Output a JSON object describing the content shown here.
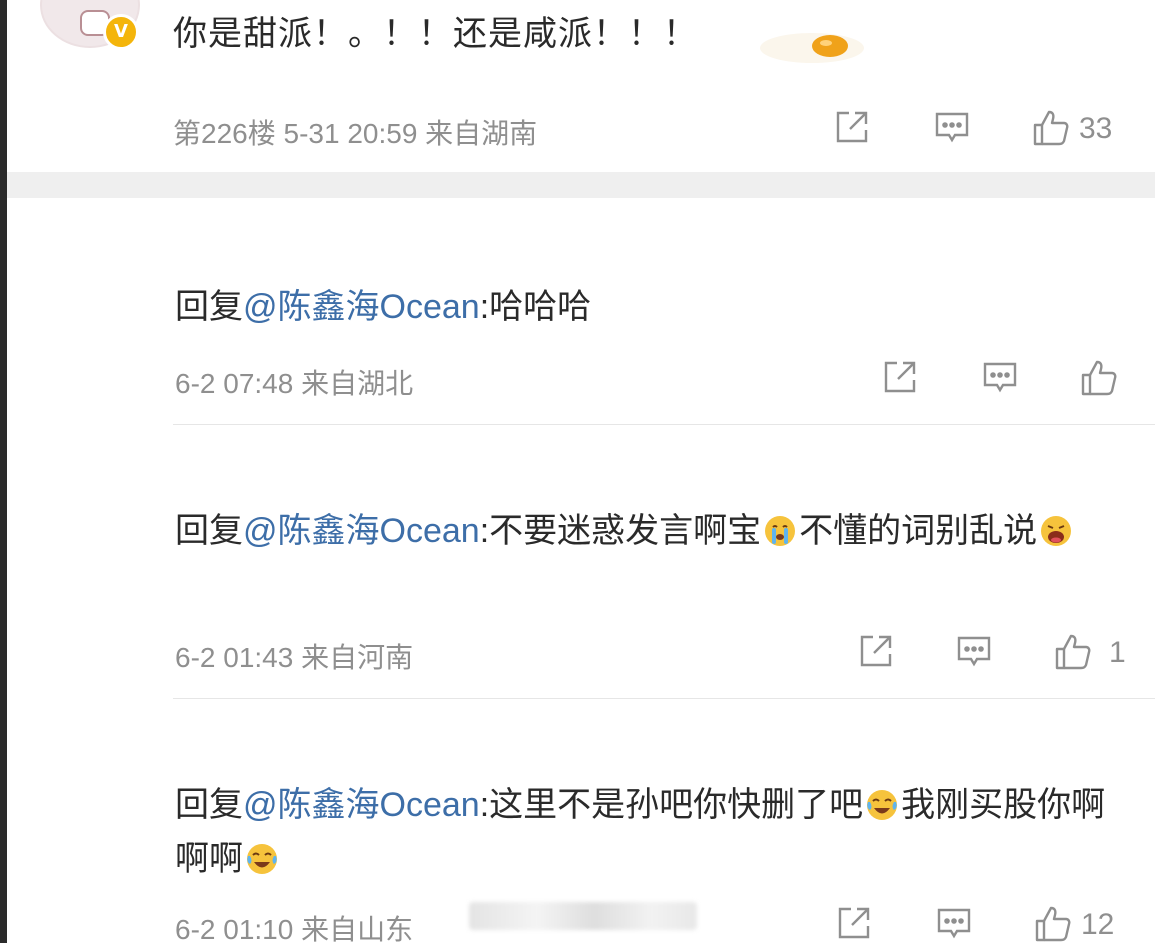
{
  "post": {
    "text": "你是甜派！。！！还是咸派！！！",
    "floor": "第226楼",
    "datetime": "5-31 20:59",
    "location": "来自湖南",
    "likes": "33"
  },
  "replies": [
    {
      "prefix": "回复",
      "mention": "@陈鑫海Ocean",
      "colon": ":",
      "body": "哈哈哈",
      "datetime": "6-2 07:48",
      "location": "来自湖北",
      "likes": ""
    },
    {
      "prefix": "回复",
      "mention": "@陈鑫海Ocean",
      "colon": ":",
      "body_part1": "不要迷惑发言啊宝",
      "emoji1": "crying-emoji",
      "body_part2": "不懂的词别乱说",
      "emoji2": "screaming-emoji",
      "datetime": "6-2 01:43",
      "location": "来自河南",
      "likes": "1"
    },
    {
      "prefix": "回复",
      "mention": "@陈鑫海Ocean",
      "colon": ":",
      "body_part1": "这里不是孙吧你快删了吧",
      "emoji1": "tears-of-joy-emoji",
      "body_part2": "我刚买股你啊啊啊",
      "emoji2": "tears-of-joy-emoji",
      "datetime": "6-2 01:10",
      "location": "来自山东",
      "likes": "12"
    }
  ],
  "icons": {
    "share": "share-icon",
    "comment": "comment-icon",
    "like": "thumbs-up-icon"
  },
  "colors": {
    "mention": "#3d6ea8",
    "meta": "#8f8f8f",
    "text": "#2a2a2a",
    "badge": "#f4b50b"
  }
}
